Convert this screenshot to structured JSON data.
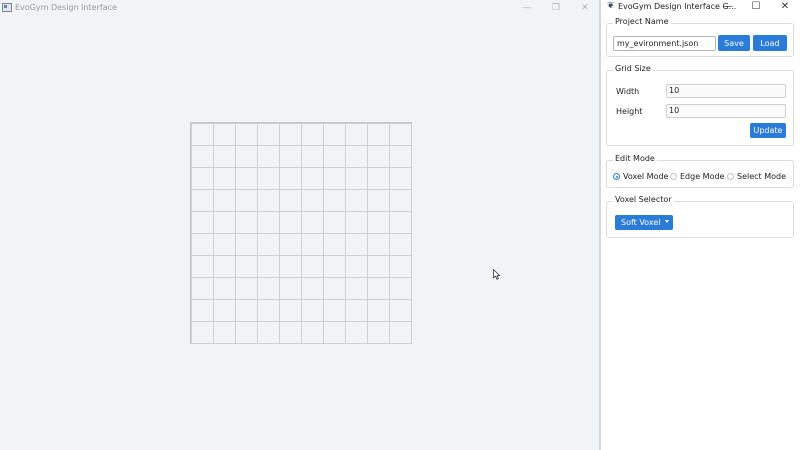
{
  "main_window": {
    "title": "EvoGym Design Interface",
    "controls": {
      "minimize": "—",
      "maximize": "❐",
      "close": "✕"
    },
    "grid": {
      "columns": 10,
      "rows": 10
    }
  },
  "side_window": {
    "title": "EvoGym Design Interface G...",
    "controls": {
      "minimize": "—",
      "maximize": "☐",
      "close": "✕"
    },
    "project": {
      "legend": "Project Name",
      "filename": "my_evironment.json",
      "save_label": "Save",
      "load_label": "Load"
    },
    "grid_size": {
      "legend": "Grid Size",
      "width_label": "Width",
      "width_value": "10",
      "height_label": "Height",
      "height_value": "10",
      "update_label": "Update"
    },
    "edit_mode": {
      "legend": "Edit Mode",
      "options": [
        {
          "label": "Voxel Mode",
          "selected": true
        },
        {
          "label": "Edge Mode",
          "selected": false
        },
        {
          "label": "Select Mode",
          "selected": false
        }
      ]
    },
    "voxel_selector": {
      "legend": "Voxel Selector",
      "selected": "Soft Voxel"
    }
  },
  "colors": {
    "accent": "#2b7bd9",
    "background": "#f2f3f5",
    "grid_line": "#cfcfcf"
  }
}
